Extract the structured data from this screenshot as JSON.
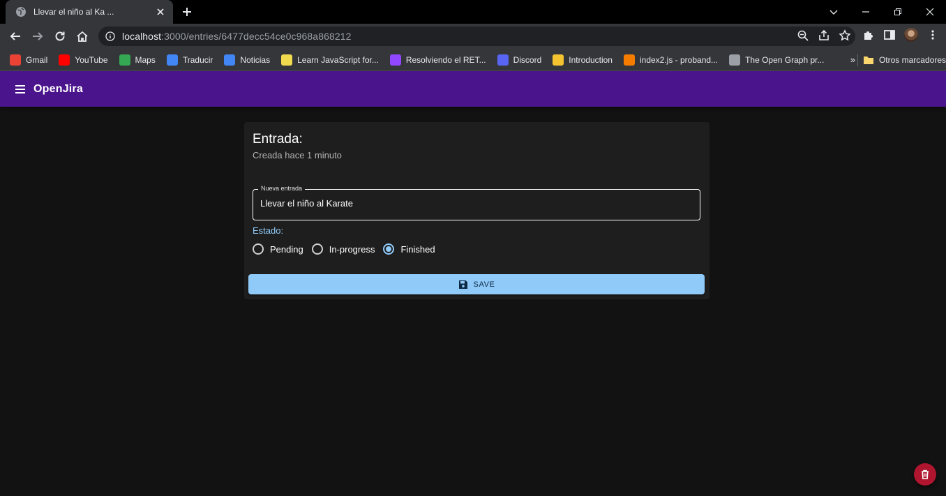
{
  "browser": {
    "tab_title": "Llevar el niño al Ka ...",
    "url_host": "localhost",
    "url_path": ":3000/entries/6477decc54ce0c968a868212",
    "bookmarks": [
      {
        "label": "Gmail",
        "icon": "gmail-icon",
        "color": "#ea4335"
      },
      {
        "label": "YouTube",
        "icon": "youtube-icon",
        "color": "#ff0000"
      },
      {
        "label": "Maps",
        "icon": "maps-icon",
        "color": "#34a853"
      },
      {
        "label": "Traducir",
        "icon": "translate-icon",
        "color": "#4285f4"
      },
      {
        "label": "Noticias",
        "icon": "news-icon",
        "color": "#4285f4"
      },
      {
        "label": "Learn JavaScript for...",
        "icon": "learn-icon",
        "color": "#f0db4f"
      },
      {
        "label": "Resolviendo el RET...",
        "icon": "twitch-icon",
        "color": "#9146ff"
      },
      {
        "label": "Discord",
        "icon": "discord-icon",
        "color": "#5865f2"
      },
      {
        "label": "Introduction",
        "icon": "introduction-icon",
        "color": "#f4c430"
      },
      {
        "label": "index2.js - proband...",
        "icon": "codepen-icon",
        "color": "#f57c00"
      },
      {
        "label": "The Open Graph pr...",
        "icon": "opengraph-icon",
        "color": "#9aa0a6"
      }
    ],
    "other_bookmarks": "Otros marcadores",
    "more_bookmarks": "»"
  },
  "app": {
    "title": "OpenJira",
    "card": {
      "title": "Entrada:",
      "subtitle": "Creada hace 1 minuto",
      "field_label": "Nueva entrada",
      "field_value": "Llevar el niño al Karate",
      "status_label": "Estado:",
      "statuses": [
        {
          "label": "Pending",
          "checked": false
        },
        {
          "label": "In-progress",
          "checked": false
        },
        {
          "label": "Finished",
          "checked": true
        }
      ],
      "save_label": "SAVE"
    }
  },
  "colors": {
    "appbar": "#4a148c",
    "accent": "#90caf9",
    "background": "#121212",
    "card": "#1e1e1e",
    "delete_fab": "#b0152f"
  }
}
